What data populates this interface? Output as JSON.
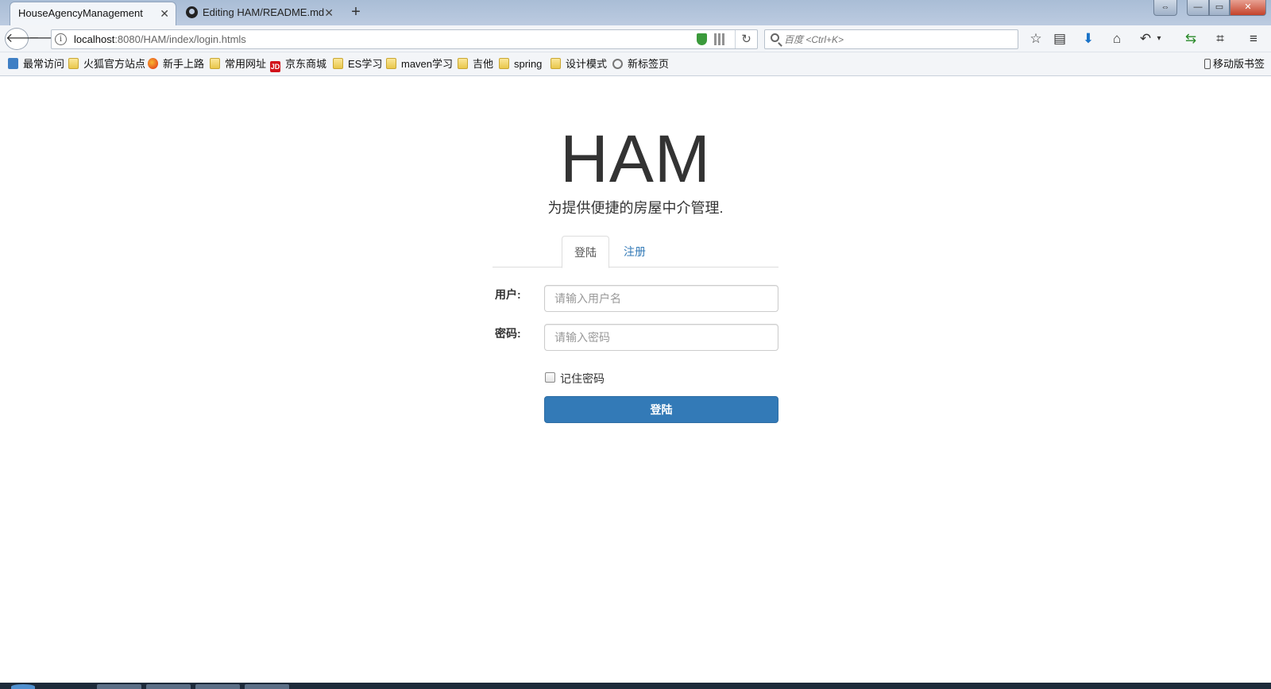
{
  "browser": {
    "tabs": [
      {
        "label": "HouseAgencyManagement",
        "active": true
      },
      {
        "label": "Editing HAM/README.md",
        "active": false
      }
    ],
    "new_tab": "+",
    "window_buttons": {
      "restore": "⇔",
      "minimize": "—",
      "maximize": "▭",
      "close": "✕"
    },
    "url": {
      "host": "localhost",
      "rest": ":8080/HAM/index/login.htmls"
    },
    "search_placeholder": "百度 <Ctrl+K>",
    "bookmarks": [
      {
        "label": "最常访问",
        "icon": "most-visited-icon"
      },
      {
        "label": "火狐官方站点",
        "icon": "folder-icon"
      },
      {
        "label": "新手上路",
        "icon": "firefox-icon"
      },
      {
        "label": "常用网址",
        "icon": "folder-icon"
      },
      {
        "label": "京东商城",
        "icon": "jd-icon"
      },
      {
        "label": "ES学习",
        "icon": "folder-icon"
      },
      {
        "label": "maven学习",
        "icon": "folder-icon"
      },
      {
        "label": "吉他",
        "icon": "folder-icon"
      },
      {
        "label": "spring",
        "icon": "folder-icon"
      },
      {
        "label": "设计模式",
        "icon": "folder-icon"
      },
      {
        "label": "新标签页",
        "icon": "globe-icon"
      }
    ],
    "mobile_bookmarks": "移动版书签",
    "jd_badge": "JD"
  },
  "login_page": {
    "title": "HAM",
    "subtitle": "为提供便捷的房屋中介管理.",
    "tabs": [
      {
        "label": "登陆",
        "active": true
      },
      {
        "label": "注册",
        "active": false
      }
    ],
    "user_label": "用户:",
    "user_placeholder": "请输入用户名",
    "pass_label": "密码:",
    "pass_placeholder": "请输入密码",
    "remember_label": "记住密码",
    "submit_label": "登陆"
  },
  "colors": {
    "primary": "#337ab7",
    "link": "#337ab7",
    "text": "#333333"
  }
}
